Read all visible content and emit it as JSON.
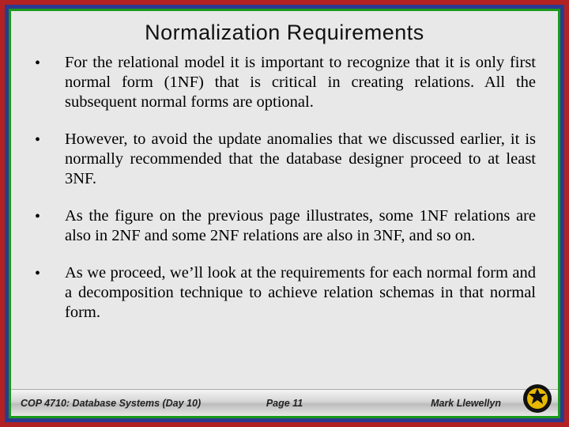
{
  "title": "Normalization Requirements",
  "bullets": [
    "For the relational model it is important to recognize that it is only first normal form (1NF) that is critical in creating relations.  All the subsequent normal forms are optional.",
    "However, to avoid the update anomalies that we discussed earlier, it is normally recommended that the database designer proceed to at least 3NF.",
    "As the figure on the previous page illustrates, some 1NF relations are also in 2NF and some 2NF relations are also in 3NF, and so on.",
    "As we proceed, we’ll look at the requirements for each normal form and a decomposition technique to achieve relation schemas in that normal form."
  ],
  "footer": {
    "course": "COP 4710: Database Systems (Day 10)",
    "page": "Page 11",
    "author": "Mark Llewellyn"
  }
}
